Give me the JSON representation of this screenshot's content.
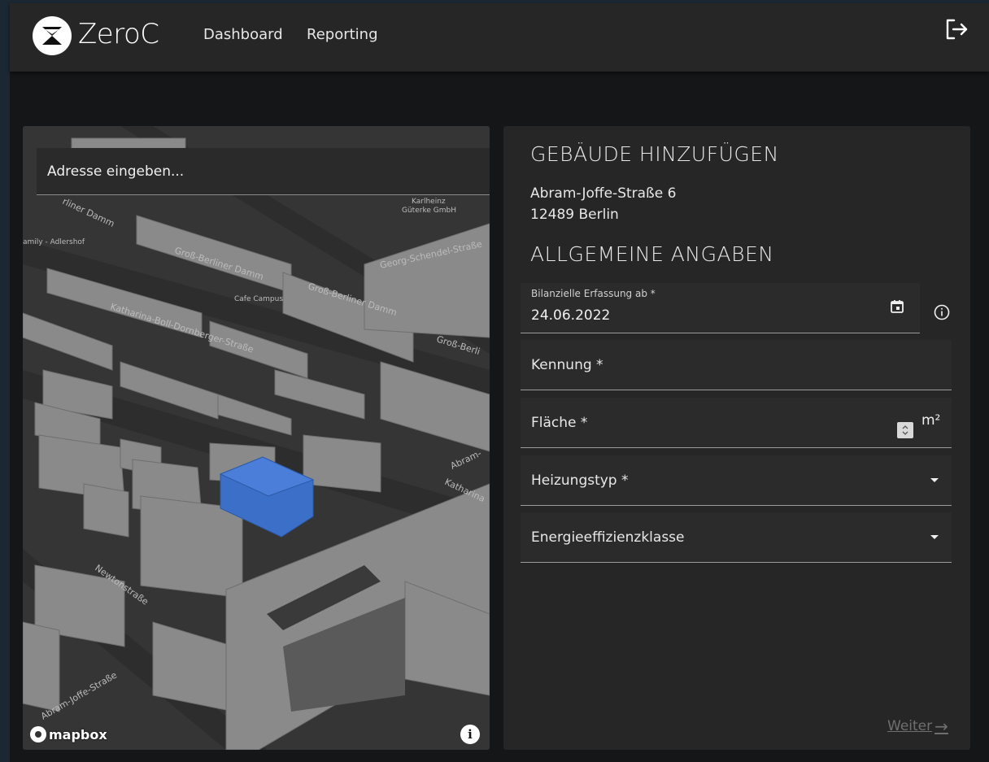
{
  "app": {
    "name": "ZeroC",
    "nav": [
      {
        "label": "Dashboard"
      },
      {
        "label": "Reporting"
      }
    ],
    "icons": {
      "logo": "zeroc-logo-icon",
      "logout": "logout-icon"
    }
  },
  "map": {
    "search_placeholder": "Adresse eingeben...",
    "attribution": "mapbox",
    "info_label": "i",
    "street_labels": [
      "Groß-Berliner Damm",
      "Groß-Berliner Damm",
      "Katharina-Boll-Dornberger-Straße",
      "Georg-Schendel-Straße",
      "Groß-Berli",
      "Newtonstraße",
      "Abram-Joffe-Straße",
      "Abram-",
      "Katharina",
      "Cafe Campus",
      "Karlheinz",
      "Güterke GmbH",
      "amily - Adlershof",
      "rliner Damm"
    ],
    "highlight_color": "#3c6fc8"
  },
  "form": {
    "title": "GEBÄUDE HINZUFÜGEN",
    "address_line1": "Abram-Joffe-Straße 6",
    "address_line2": "12489 Berlin",
    "section_title": "ALLGEMEINE ANGABEN",
    "fields": {
      "date_label": "Bilanzielle Erfassung ab *",
      "date_value": "24.06.2022",
      "kennung_label": "Kennung *",
      "flaeche_label": "Fläche *",
      "flaeche_unit": "m²",
      "heizung_label": "Heizungstyp *",
      "energie_label": "Energieeffizienzklasse"
    },
    "next_label": "Weiter",
    "next_arrow": "→"
  }
}
